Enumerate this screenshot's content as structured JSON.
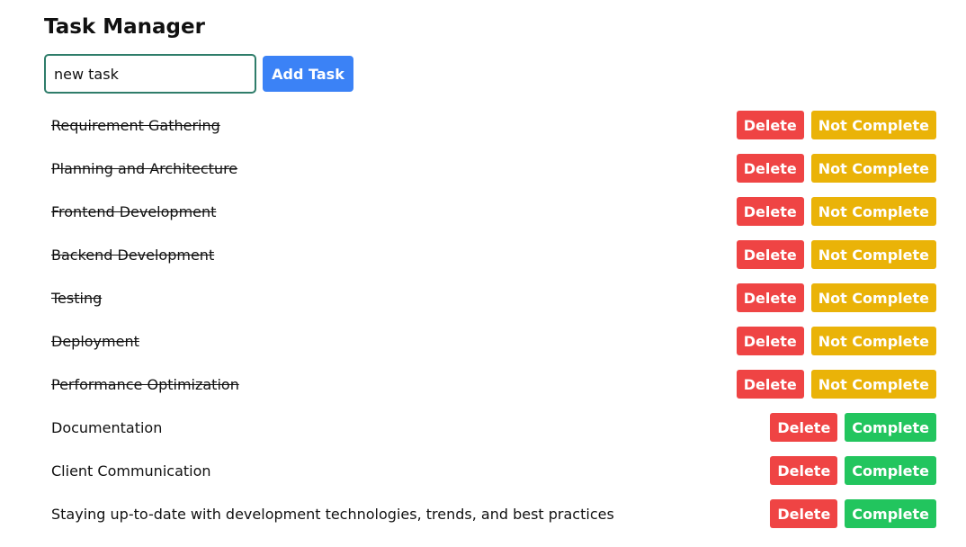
{
  "header": {
    "title": "Task Manager"
  },
  "add_form": {
    "input_value": "new task",
    "add_button_label": "Add Task"
  },
  "colors": {
    "add_button": "#3b82f6",
    "delete_button": "#ef4444",
    "not_complete_button": "#eab308",
    "complete_button": "#22c55e",
    "input_border": "#2f7d6a"
  },
  "tasks": [
    {
      "text": "Requirement Gathering",
      "completed": true,
      "delete_label": "Delete",
      "toggle_label": "Not Complete"
    },
    {
      "text": "Planning and Architecture",
      "completed": true,
      "delete_label": "Delete",
      "toggle_label": "Not Complete"
    },
    {
      "text": "Frontend Development",
      "completed": true,
      "delete_label": "Delete",
      "toggle_label": "Not Complete"
    },
    {
      "text": "Backend Development",
      "completed": true,
      "delete_label": "Delete",
      "toggle_label": "Not Complete"
    },
    {
      "text": "Testing",
      "completed": true,
      "delete_label": "Delete",
      "toggle_label": "Not Complete"
    },
    {
      "text": "Deployment",
      "completed": true,
      "delete_label": "Delete",
      "toggle_label": "Not Complete"
    },
    {
      "text": "Performance Optimization",
      "completed": true,
      "delete_label": "Delete",
      "toggle_label": "Not Complete"
    },
    {
      "text": "Documentation",
      "completed": false,
      "delete_label": "Delete",
      "toggle_label": "Complete"
    },
    {
      "text": "Client Communication",
      "completed": false,
      "delete_label": "Delete",
      "toggle_label": "Complete"
    },
    {
      "text": "Staying up-to-date with development technologies, trends, and best practices",
      "completed": false,
      "delete_label": "Delete",
      "toggle_label": "Complete"
    }
  ]
}
